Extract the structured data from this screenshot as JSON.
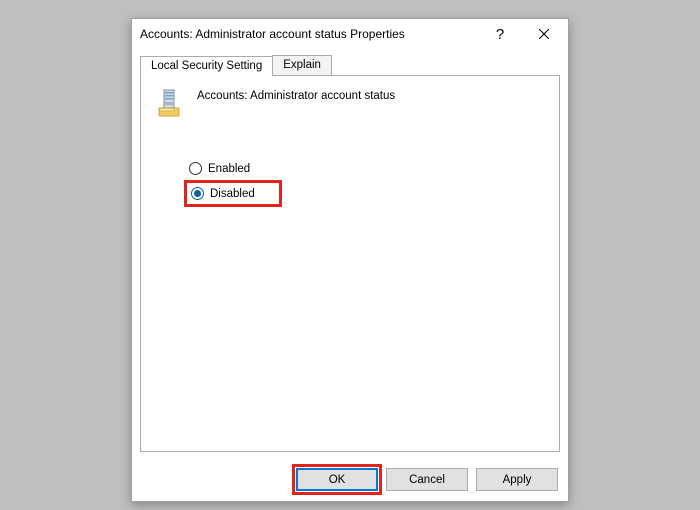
{
  "titlebar": {
    "title": "Accounts: Administrator account status Properties"
  },
  "tabs": {
    "local_security": "Local Security Setting",
    "explain": "Explain"
  },
  "content": {
    "policy_name": "Accounts: Administrator account status",
    "options": {
      "enabled": "Enabled",
      "disabled": "Disabled"
    }
  },
  "buttons": {
    "ok": "OK",
    "cancel": "Cancel",
    "apply": "Apply"
  }
}
